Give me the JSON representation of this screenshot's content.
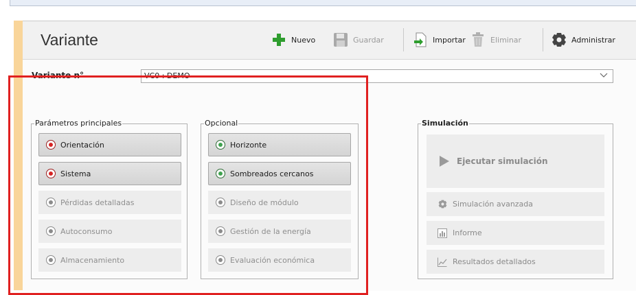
{
  "header": {
    "title": "Variante",
    "toolbar": {
      "nuevo": "Nuevo",
      "guardar": "Guardar",
      "importar": "Importar",
      "eliminar": "Eliminar",
      "administrar": "Administrar"
    }
  },
  "variante": {
    "label": "Variante n°",
    "value": "VC0      : DEMO"
  },
  "principales": {
    "legend": "Parámetros principales",
    "items": [
      {
        "label": "Orientación",
        "state": "error"
      },
      {
        "label": "Sistema",
        "state": "error"
      },
      {
        "label": "Pérdidas detalladas",
        "state": "disabled"
      },
      {
        "label": "Autoconsumo",
        "state": "disabled"
      },
      {
        "label": "Almacenamiento",
        "state": "disabled"
      }
    ]
  },
  "opcional": {
    "legend": "Opcional",
    "items": [
      {
        "label": "Horizonte",
        "state": "ok"
      },
      {
        "label": "Sombreados cercanos",
        "state": "ok"
      },
      {
        "label": "Diseño de módulo",
        "state": "disabled"
      },
      {
        "label": "Gestión de la energía",
        "state": "disabled"
      },
      {
        "label": "Evaluación económica",
        "state": "disabled"
      }
    ]
  },
  "simulacion": {
    "legend": "Simulación",
    "run": "Ejecutar simulación",
    "avanzada": "Simulación avanzada",
    "informe": "Informe",
    "resultados": "Resultados detallados"
  },
  "colors": {
    "accent_strip": "#f9d59a",
    "error_dot": "#d62424",
    "ok_dot": "#3fa24f",
    "highlight": "#e02020"
  }
}
